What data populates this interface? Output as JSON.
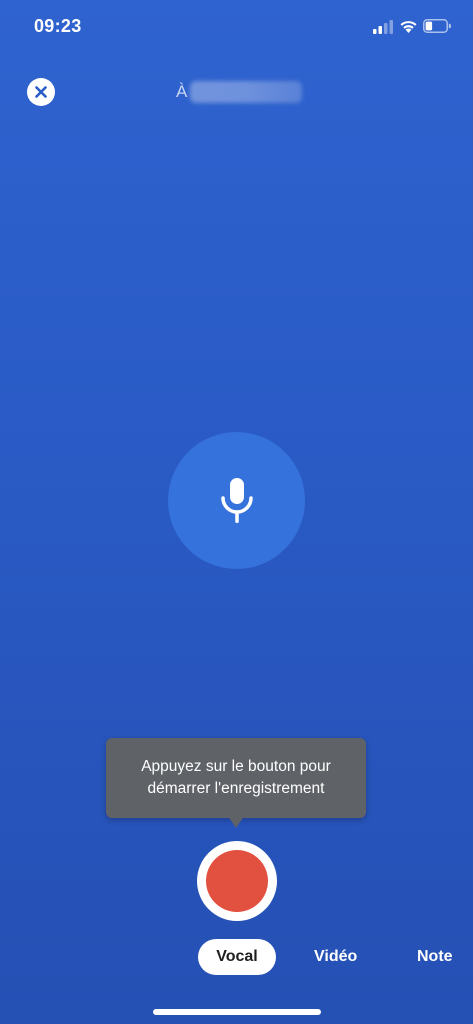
{
  "status_bar": {
    "time": "09:23",
    "icons": [
      "signal-icon",
      "wifi-icon",
      "battery-icon"
    ]
  },
  "header": {
    "close_icon": "close-icon",
    "recipient_prefix": "À"
  },
  "mic": {
    "icon": "microphone-icon"
  },
  "tooltip": {
    "line1": "Appuyez sur le bouton pour",
    "line2": "démarrer l'enregistrement"
  },
  "record_button": {
    "icon": "record-dot"
  },
  "tabs": [
    {
      "label": "Vocal",
      "selected": true
    },
    {
      "label": "Vidéo",
      "selected": false
    },
    {
      "label": "Note",
      "selected": false
    }
  ],
  "colors": {
    "background": "#2a5bc6",
    "mic_circle": "#3672db",
    "record_red": "#e2503f",
    "tooltip_bg": "#5f6368"
  }
}
